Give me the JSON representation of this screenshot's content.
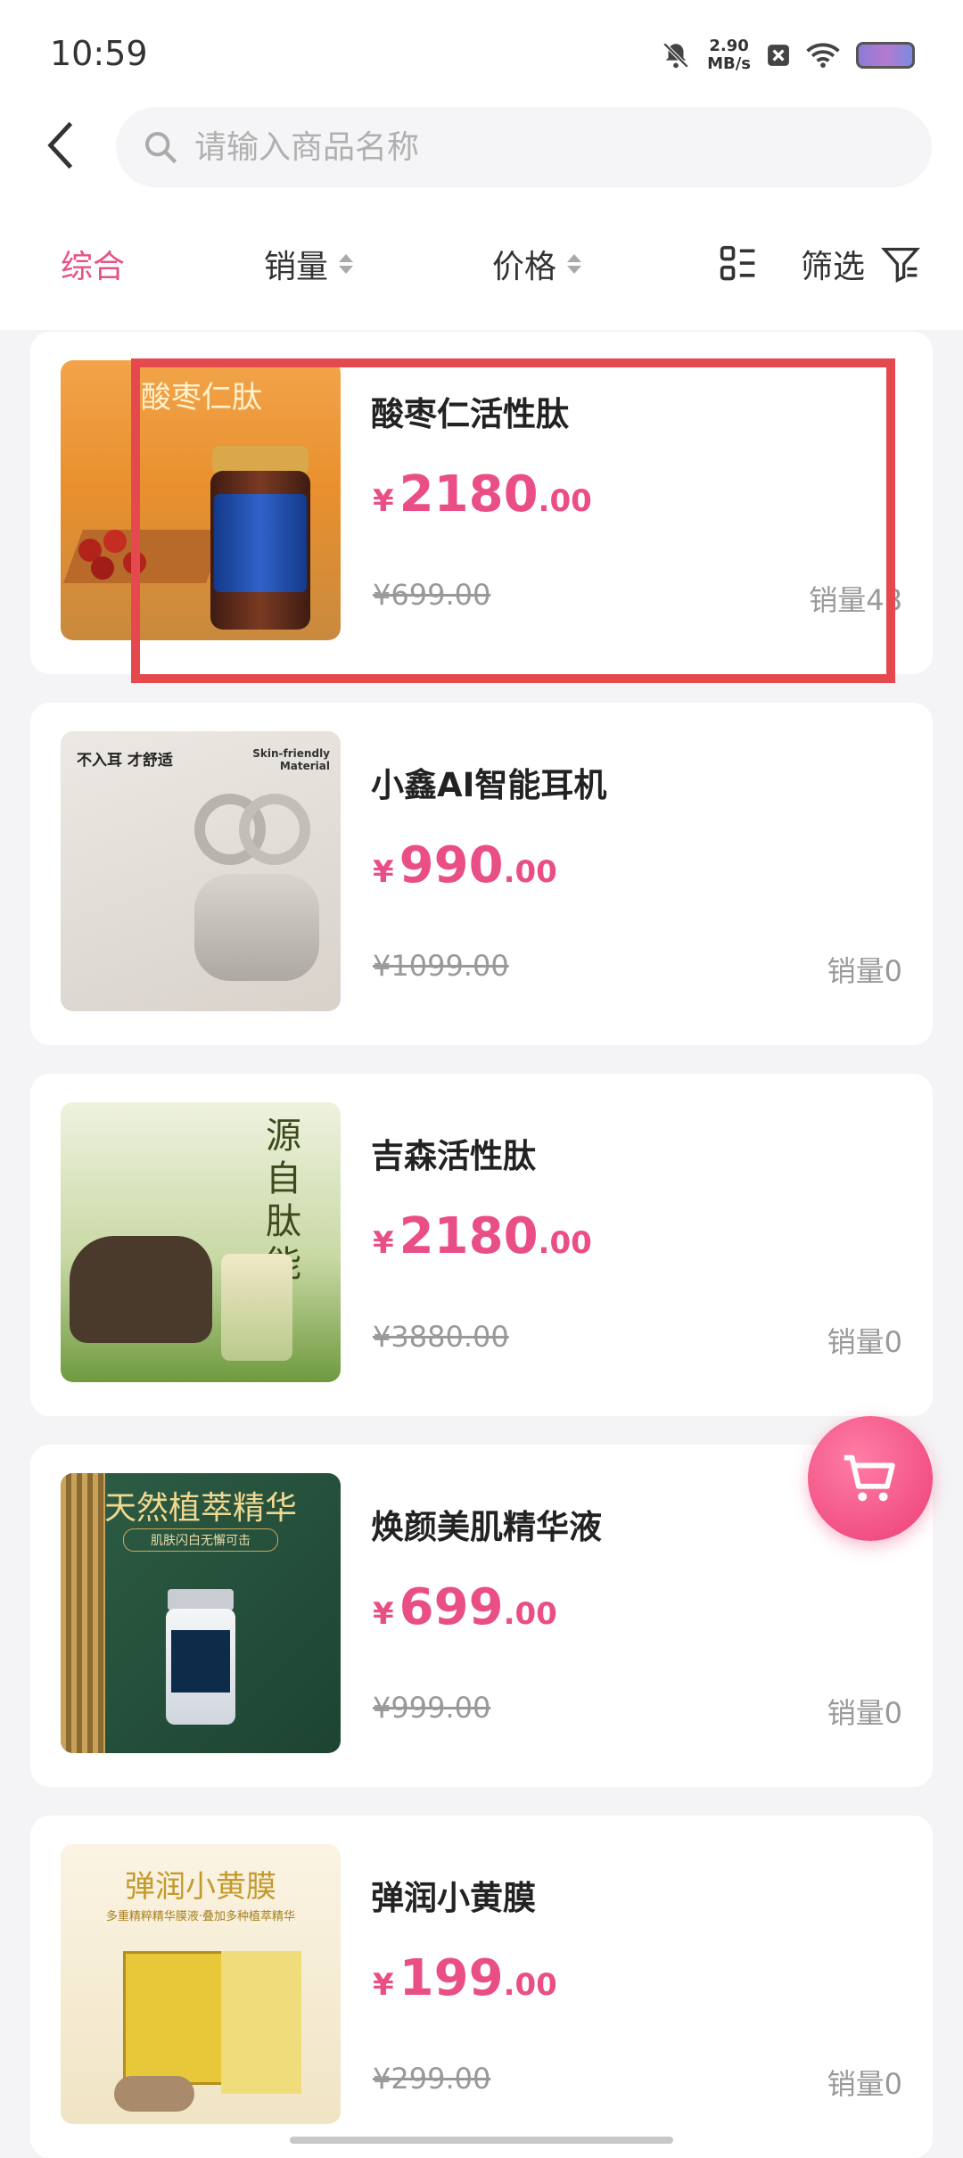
{
  "status_bar": {
    "time": "10:59",
    "speed_value": "2.90",
    "speed_unit": "MB/s"
  },
  "search": {
    "placeholder": "请输入商品名称"
  },
  "filters": {
    "comprehensive": "综合",
    "sales": "销量",
    "price": "价格",
    "filter": "筛选"
  },
  "colors": {
    "accent": "#e94f86",
    "highlight": "#e5484d"
  },
  "products": [
    {
      "name": "酸枣仁活性肽",
      "currency": "¥",
      "price_int": "2180",
      "price_dec": ".00",
      "original_price": "¥699.00",
      "sales": "销量48",
      "image_title": "酸枣仁肽"
    },
    {
      "name": "小鑫AI智能耳机",
      "currency": "¥",
      "price_int": "990",
      "price_dec": ".00",
      "original_price": "¥1099.00",
      "sales": "销量0",
      "image_title": "不入耳 才舒适",
      "image_sub": "Skin-friendly Material"
    },
    {
      "name": "吉森活性肽",
      "currency": "¥",
      "price_int": "2180",
      "price_dec": ".00",
      "original_price": "¥3880.00",
      "sales": "销量0",
      "image_title": "源自肽能"
    },
    {
      "name": "焕颜美肌精华液",
      "currency": "¥",
      "price_int": "699",
      "price_dec": ".00",
      "original_price": "¥999.00",
      "sales": "销量0",
      "image_title": "天然植萃精华",
      "image_sub": "肌肤闪白无懈可击"
    },
    {
      "name": "弹润小黄膜",
      "currency": "¥",
      "price_int": "199",
      "price_dec": ".00",
      "original_price": "¥299.00",
      "sales": "销量0",
      "image_title": "弹润小黄膜",
      "image_sub": "多重精粹精华膜液·叠加多种植萃精华"
    }
  ]
}
